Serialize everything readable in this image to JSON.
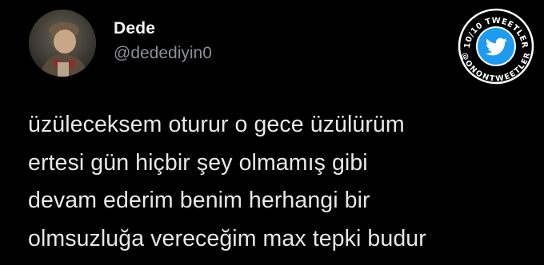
{
  "tweet": {
    "author_name": "Dede",
    "author_handle": "@dedediyin0",
    "lines": [
      "üzüleceksem oturur o gece üzülürüm",
      "ertesi gün hiçbir şey olmamış gibi",
      "devam ederim benim herhangi bir",
      "olmsuzluğa vereceğim max tepki budur"
    ]
  },
  "badge": {
    "top_text": "10/10 TWEETLER",
    "bottom_text": "@ONONTWEETLER",
    "icon": "twitter-bird-icon",
    "circle_color": "#1d9bf0",
    "ring_color": "#ffffff"
  },
  "colors": {
    "background": "#000000",
    "text": "#e8e8e8",
    "handle": "#8b9096"
  }
}
